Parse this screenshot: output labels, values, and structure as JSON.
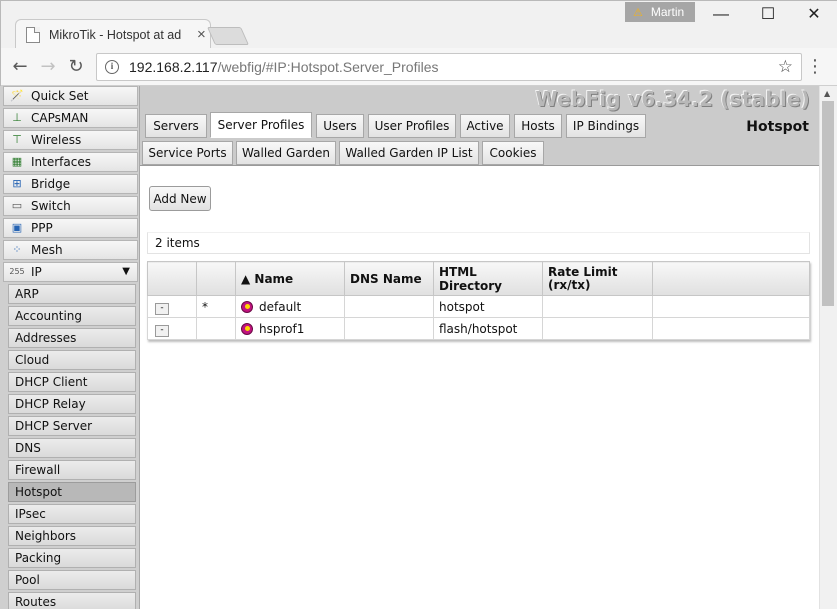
{
  "browser": {
    "tab_title": "MikroTik - Hotspot at ad",
    "tab_close": "×",
    "profile_name": "Martin",
    "url_host": "192.168.2.117",
    "url_path": "/webfig/#IP:Hotspot.Server_Profiles",
    "window_minimize": "—",
    "window_maximize": "☐",
    "window_close": "✕"
  },
  "sidebar": {
    "items": [
      {
        "label": "Quick Set",
        "icon": "wand-icon"
      },
      {
        "label": "CAPsMAN",
        "icon": "antenna-icon"
      },
      {
        "label": "Wireless",
        "icon": "wireless-icon"
      },
      {
        "label": "Interfaces",
        "icon": "interfaces-icon"
      },
      {
        "label": "Bridge",
        "icon": "bridge-icon"
      },
      {
        "label": "Switch",
        "icon": "switch-icon"
      },
      {
        "label": "PPP",
        "icon": "ppp-icon"
      },
      {
        "label": "Mesh",
        "icon": "mesh-icon"
      },
      {
        "label": "IP",
        "icon": "ip-icon"
      }
    ],
    "ip_expand_arrow": "▼",
    "ip_submenu": [
      "ARP",
      "Accounting",
      "Addresses",
      "Cloud",
      "DHCP Client",
      "DHCP Relay",
      "DHCP Server",
      "DNS",
      "Firewall",
      "Hotspot",
      "IPsec",
      "Neighbors",
      "Packing",
      "Pool",
      "Routes"
    ],
    "active_submenu": "Hotspot"
  },
  "header": {
    "version": "WebFig v6.34.2 (stable)",
    "section_title": "Hotspot"
  },
  "tabs_row1": [
    "Servers",
    "Server Profiles",
    "Users",
    "User Profiles",
    "Active",
    "Hosts",
    "IP Bindings"
  ],
  "tabs_row2": [
    "Service Ports",
    "Walled Garden",
    "Walled Garden IP List",
    "Cookies"
  ],
  "active_tab": "Server Profiles",
  "toolbar": {
    "add_new": "Add New"
  },
  "list": {
    "count_text": "2 items",
    "columns": [
      "",
      "",
      "▲ Name",
      "DNS Name",
      "HTML Directory",
      "Rate Limit (rx/tx)",
      ""
    ],
    "rows": [
      {
        "remove": "-",
        "flag": "*",
        "name": "default",
        "dns_name": "",
        "html_directory": "hotspot",
        "rate_limit": ""
      },
      {
        "remove": "-",
        "flag": "",
        "name": "hsprof1",
        "dns_name": "",
        "html_directory": "flash/hotspot",
        "rate_limit": ""
      }
    ]
  }
}
